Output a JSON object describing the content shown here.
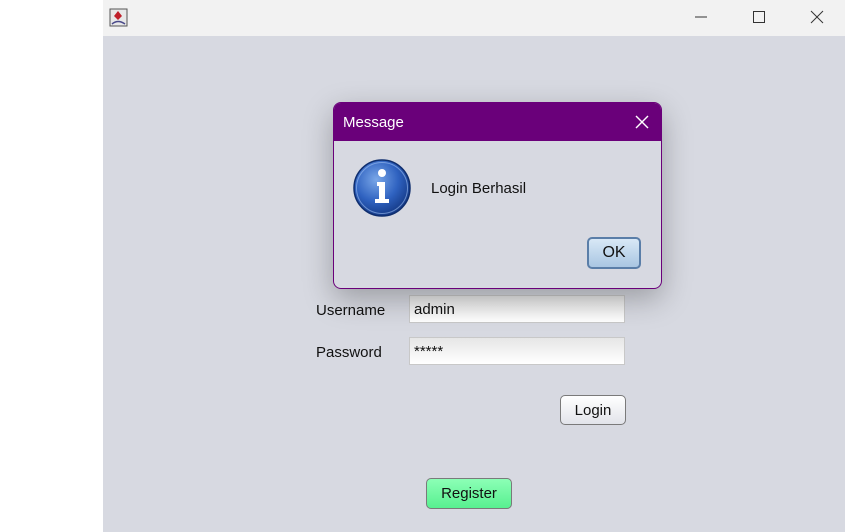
{
  "titlebar": {
    "app_icon": "java-app-icon",
    "controls": [
      "minimize-icon",
      "maximize-icon",
      "close-icon"
    ]
  },
  "form": {
    "username_label": "Username",
    "username_value": "admin",
    "password_label": "Password",
    "password_value": "*****",
    "login_label": "Login",
    "register_label": "Register"
  },
  "dialog": {
    "title": "Message",
    "icon": "info-icon",
    "message": "Login Berhasil",
    "ok_label": "OK"
  },
  "colors": {
    "dialog_titlebar": "#6a007a",
    "window_background": "#d7d9e1",
    "register_button": "#58f090",
    "ok_button": "#a9c6e2"
  }
}
